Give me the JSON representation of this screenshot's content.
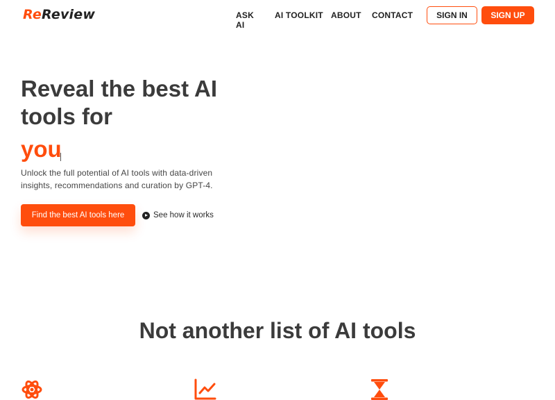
{
  "header": {
    "logo_prefix": "Re",
    "logo_suffix": "Review",
    "nav": {
      "ask_ai": "ASK AI",
      "toolkit": "AI TOOLKIT",
      "about": "ABOUT",
      "contact": "CONTACT"
    },
    "signin_label": "SIGN IN",
    "signup_label": "SIGN UP"
  },
  "hero": {
    "title": "Reveal the best AI tools for",
    "accent_word": "you",
    "subtitle": "Unlock the full potential of AI tools with data-driven insights, recommendations and curation by GPT-4.",
    "cta_label": "Find the best AI tools here",
    "how_it_works_label": "See how it works"
  },
  "features": {
    "title": "Not another list of AI tools",
    "icons": [
      "atom-icon",
      "chart-line-icon",
      "hourglass-icon"
    ]
  },
  "colors": {
    "accent": "#ff4d0d",
    "text": "#3b3b3b"
  }
}
